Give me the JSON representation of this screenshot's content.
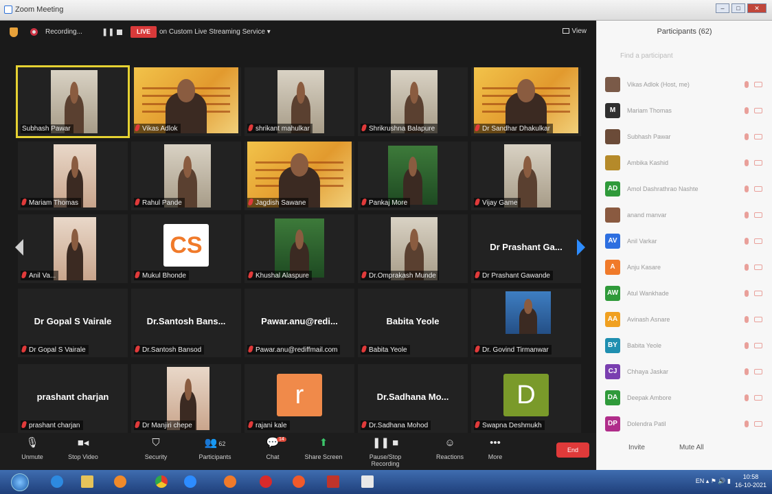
{
  "window": {
    "title": "Zoom Meeting",
    "controls": [
      "–",
      "□",
      "✕"
    ]
  },
  "topbar": {
    "recording_label": "Recording...",
    "pause_glyph": "❚❚",
    "live_badge": "LIVE",
    "stream_label": "on Custom Live Streaming Service ▾",
    "view_label": "View"
  },
  "tiles": [
    {
      "name": "Subhash Pawar",
      "big": "",
      "avatar": "",
      "style": "room",
      "active": true
    },
    {
      "name": "Vikas Adlok",
      "big": "",
      "avatar": "",
      "style": "banner"
    },
    {
      "name": "shrikant mahulkar",
      "big": "",
      "avatar": "",
      "style": "room"
    },
    {
      "name": "Shrikrushna Balapure",
      "big": "",
      "avatar": "",
      "style": "room"
    },
    {
      "name": "Dr Sandhar Dhakulkar",
      "big": "",
      "avatar": "",
      "style": "banner"
    },
    {
      "name": "Mariam Thomas",
      "big": "",
      "avatar": "",
      "style": "warm"
    },
    {
      "name": "Rahul Pande",
      "big": "",
      "avatar": "",
      "style": "room"
    },
    {
      "name": "Jagdish Sawane",
      "big": "",
      "avatar": "",
      "style": "banner"
    },
    {
      "name": "Pankaj More",
      "big": "",
      "avatar": "",
      "style": "green"
    },
    {
      "name": "Vijay Game",
      "big": "",
      "avatar": "",
      "style": "room"
    },
    {
      "name": "Anil Va...",
      "big": "",
      "avatar": "",
      "style": "warm"
    },
    {
      "name": "Mukul Bhonde",
      "big": "",
      "avatar": "CS",
      "style": "logo"
    },
    {
      "name": "Khushal Alaspure",
      "big": "",
      "avatar": "",
      "style": "green"
    },
    {
      "name": "Dr.Omprakash Munde",
      "big": "",
      "avatar": "",
      "style": "room"
    },
    {
      "name": "Dr Prashant Gawande",
      "big": "Dr Prashant Ga...",
      "avatar": "",
      "style": "none"
    },
    {
      "name": "Dr Gopal S Vairale",
      "big": "Dr Gopal S Vairale",
      "avatar": "",
      "style": "none"
    },
    {
      "name": "Dr.Santosh Bansod",
      "big": "Dr.Santosh Bans...",
      "avatar": "",
      "style": "none"
    },
    {
      "name": "Pawar.anu@rediffmail.com",
      "big": "Pawar.anu@redi...",
      "avatar": "",
      "style": "none"
    },
    {
      "name": "Babita Yeole",
      "big": "Babita Yeole",
      "avatar": "",
      "style": "none"
    },
    {
      "name": "Dr. Govind Tirmanwar",
      "big": "",
      "avatar": "",
      "style": "blue"
    },
    {
      "name": "prashant charjan",
      "big": "prashant charjan",
      "avatar": "",
      "style": "none"
    },
    {
      "name": "Dr Manjiri chepe",
      "big": "",
      "avatar": "",
      "style": "warm"
    },
    {
      "name": "rajani kale",
      "big": "",
      "avatar": "r",
      "style": "orange"
    },
    {
      "name": "Dr.Sadhana Mohod",
      "big": "Dr.Sadhana  Mo...",
      "avatar": "",
      "style": "none"
    },
    {
      "name": "Swapna Deshmukh",
      "big": "",
      "avatar": "D",
      "style": "olive"
    }
  ],
  "toolbar": {
    "unmute": "Unmute",
    "stop_video": "Stop Video",
    "security": "Security",
    "participants": "Participants",
    "participants_count": "62",
    "chat": "Chat",
    "chat_badge": "14",
    "share_screen": "Share Screen",
    "pause_stop_recording": "Pause/Stop Recording",
    "reactions": "Reactions",
    "more": "More",
    "end": "End"
  },
  "panel": {
    "title": "Participants (62)",
    "search_placeholder": "Find a participant",
    "participants": [
      {
        "initials": "",
        "name": "Vikas Adlok (Host, me)",
        "color": "#7a5a48"
      },
      {
        "initials": "M",
        "name": "Mariam Thomas",
        "color": "#2f2f2f"
      },
      {
        "initials": "",
        "name": "Subhash Pawar",
        "color": "#6b4b38"
      },
      {
        "initials": "",
        "name": "Ambika Kashid",
        "color": "#b58a2a"
      },
      {
        "initials": "AD",
        "name": "Amol Dashrathrao Nashte",
        "color": "#2f9a3a"
      },
      {
        "initials": "",
        "name": "anand manvar",
        "color": "#8a5a40"
      },
      {
        "initials": "AV",
        "name": "Anil Varkar",
        "color": "#2d6fe0"
      },
      {
        "initials": "A",
        "name": "Anju Kasare",
        "color": "#f07a2a"
      },
      {
        "initials": "AW",
        "name": "Atul Wankhade",
        "color": "#2f9a3a"
      },
      {
        "initials": "AA",
        "name": "Avinash Asnare",
        "color": "#f0a020"
      },
      {
        "initials": "BY",
        "name": "Babita Yeole",
        "color": "#1f8fb0"
      },
      {
        "initials": "CJ",
        "name": "Chhaya Jaskar",
        "color": "#7a3fb0"
      },
      {
        "initials": "DA",
        "name": "Deepak Ambore",
        "color": "#2f9a3a"
      },
      {
        "initials": "DP",
        "name": "Dolendra Patil",
        "color": "#b02d8a"
      }
    ],
    "invite": "Invite",
    "mute_all": "Mute All"
  },
  "taskbar": {
    "tray_lang": "EN",
    "time": "10:58",
    "date": "16-10-2021"
  }
}
